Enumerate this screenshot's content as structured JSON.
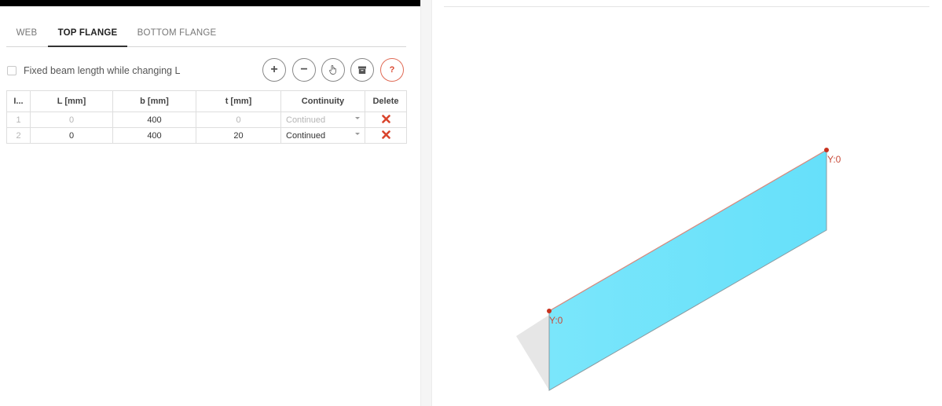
{
  "tabs": {
    "web": "WEB",
    "top_flange": "TOP FLANGE",
    "bottom_flange": "BOTTOM FLANGE"
  },
  "toolbar": {
    "fixed_length_label": "Fixed beam length while changing L",
    "add": "+",
    "remove": "−",
    "help": "?"
  },
  "table": {
    "headers": [
      "I...",
      "L [mm]",
      "b [mm]",
      "t [mm]",
      "Continuity",
      "Delete"
    ],
    "rows": [
      {
        "index": "1",
        "L": "0",
        "b": "400",
        "t": "0",
        "continuity": "Continued"
      },
      {
        "index": "2",
        "L": "0",
        "b": "400",
        "t": "20",
        "continuity": "Continued"
      }
    ]
  },
  "viewport": {
    "labels": [
      "Y:0",
      "Y:0"
    ]
  },
  "colors": {
    "accent_red": "#d9442c",
    "flange_fill": "#6fe3fb"
  }
}
